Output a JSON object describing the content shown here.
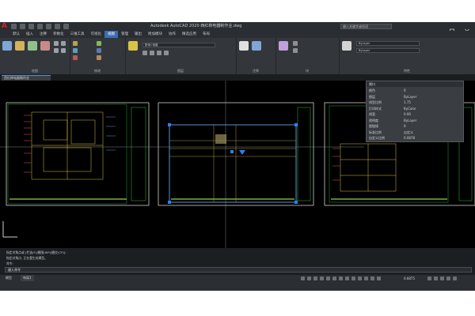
{
  "app": {
    "title": "Autodesk AutoCAD 2020   西红柿电器制作业.dwg",
    "search_placeholder": "键入关键字或短语",
    "colors": {
      "accent": "#3a6fb0",
      "grip": "#2a7fff",
      "drawing_line": "#d9c24a"
    }
  },
  "ribbon_tabs": [
    "默认",
    "插入",
    "注释",
    "参数化",
    "三维工具",
    "可视化",
    "视图",
    "管理",
    "输出",
    "附加模块",
    "协作",
    "精选应用",
    "布局"
  ],
  "active_tab_index": 6,
  "ribbon_groups": [
    "绘图",
    "修改",
    "图层",
    "注释",
    "块",
    "特性"
  ],
  "ribbon": {
    "layer_dropdown": "配电C电路",
    "color_dropdown": "ByLayer",
    "linetype_dropdown": "ByLayer"
  },
  "document_tab": "西红柿电器制作业",
  "properties": {
    "header": "视口",
    "rows": [
      {
        "k": "颜色",
        "v": "0"
      },
      {
        "k": "图层",
        "v": "ByLayer"
      },
      {
        "k": "线型比例",
        "v": "1.75"
      },
      {
        "k": "打印样式",
        "v": "ByColor"
      },
      {
        "k": "线宽",
        "v": "0.00"
      },
      {
        "k": "透明度",
        "v": "ByLayer"
      },
      {
        "k": "超链接",
        "v": "0"
      },
      {
        "k": "标准比例",
        "v": "自定义"
      },
      {
        "k": "自定义比例",
        "v": "0.0878"
      }
    ]
  },
  "command": {
    "lines": [
      "指定对角点或 [栏选(F)/圈围(WP)/圈交(CP)]:",
      "指定对角点:  正在重生成模型。"
    ],
    "prompt_label": "命令:",
    "input_value": "键入命令"
  },
  "status": {
    "model_tab": "模型",
    "layout_tab": "布局1",
    "zoom": "0.6875"
  },
  "icons": [
    "autocad-logo-icon",
    "save-icon",
    "undo-icon",
    "redo-icon",
    "line-icon",
    "polyline-icon",
    "circle-icon",
    "move-icon",
    "copy-icon",
    "layer-icon",
    "grip-icon"
  ]
}
